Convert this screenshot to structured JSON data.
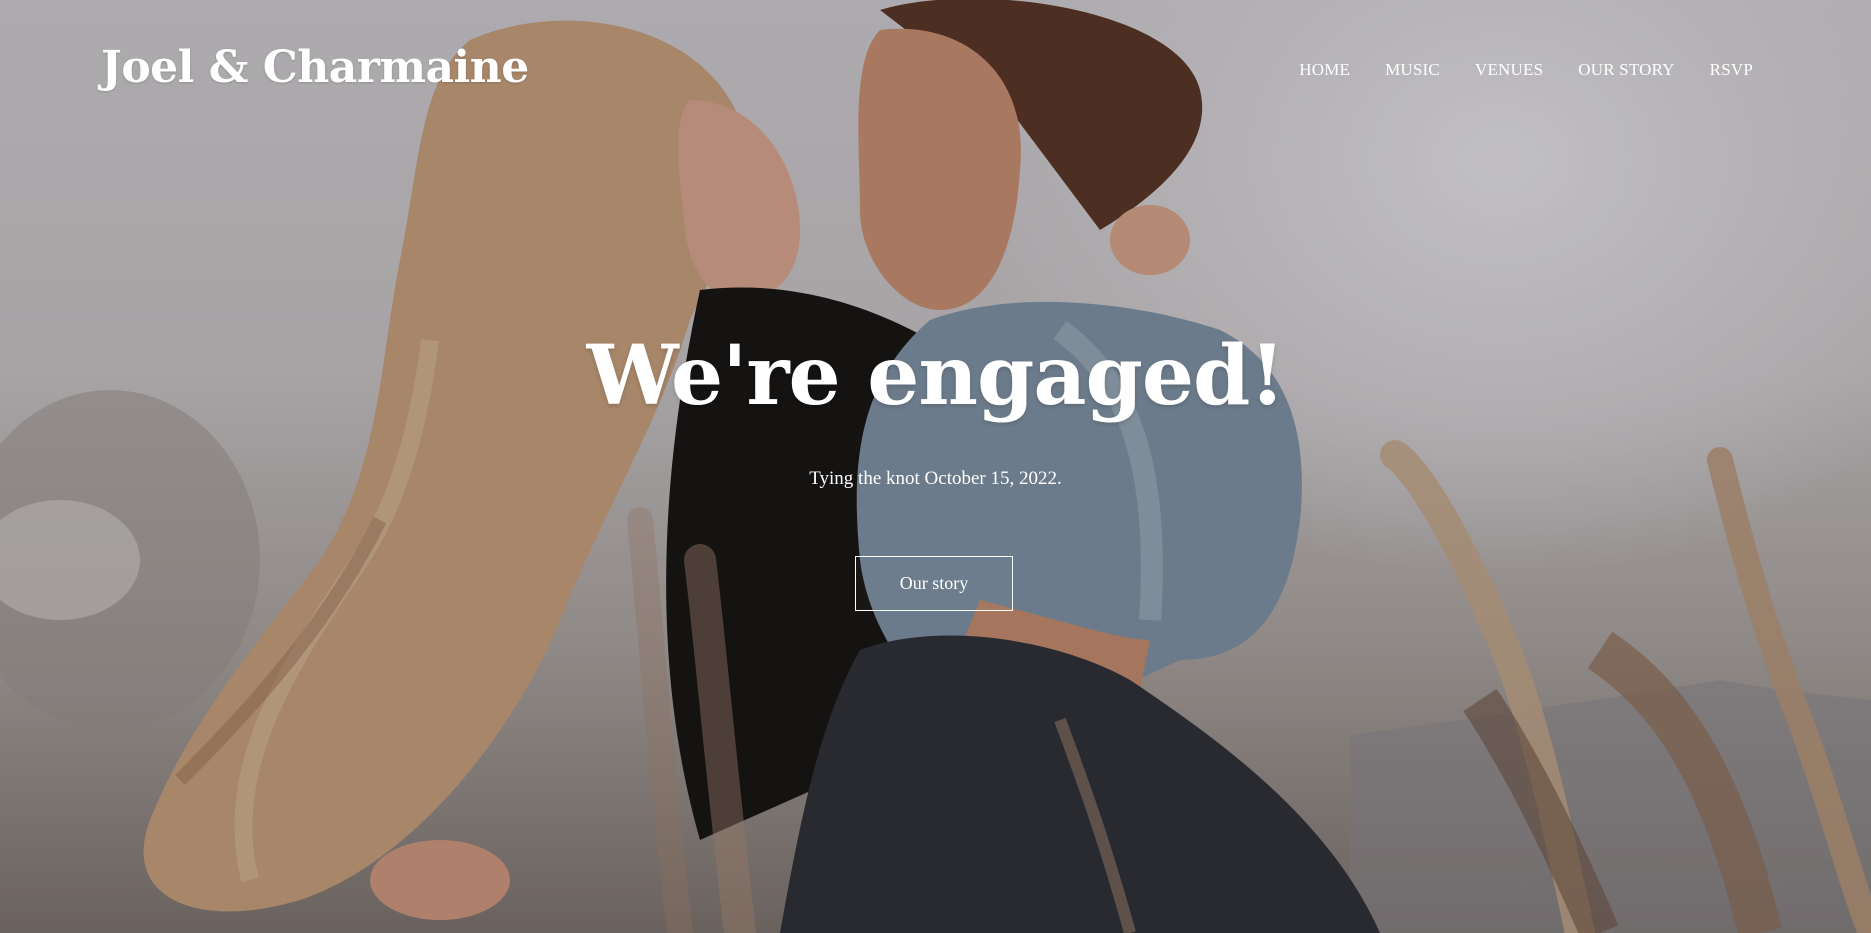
{
  "site": {
    "brand": "Joel & Charmaine"
  },
  "nav": {
    "items": [
      {
        "label": "HOME"
      },
      {
        "label": "MUSIC"
      },
      {
        "label": "VENUES"
      },
      {
        "label": "OUR STORY"
      },
      {
        "label": "RSVP"
      }
    ]
  },
  "hero": {
    "headline": "We're engaged!",
    "subline": "Tying the knot October 15, 2022.",
    "cta_label": "Our story",
    "image": "engaged-couple-in-field-photo"
  },
  "colors": {
    "text": "#ffffff",
    "sky": "#d9d7dc",
    "denim": "#7f93a6",
    "hair": "#c9a27e",
    "dark_top": "#141212"
  }
}
